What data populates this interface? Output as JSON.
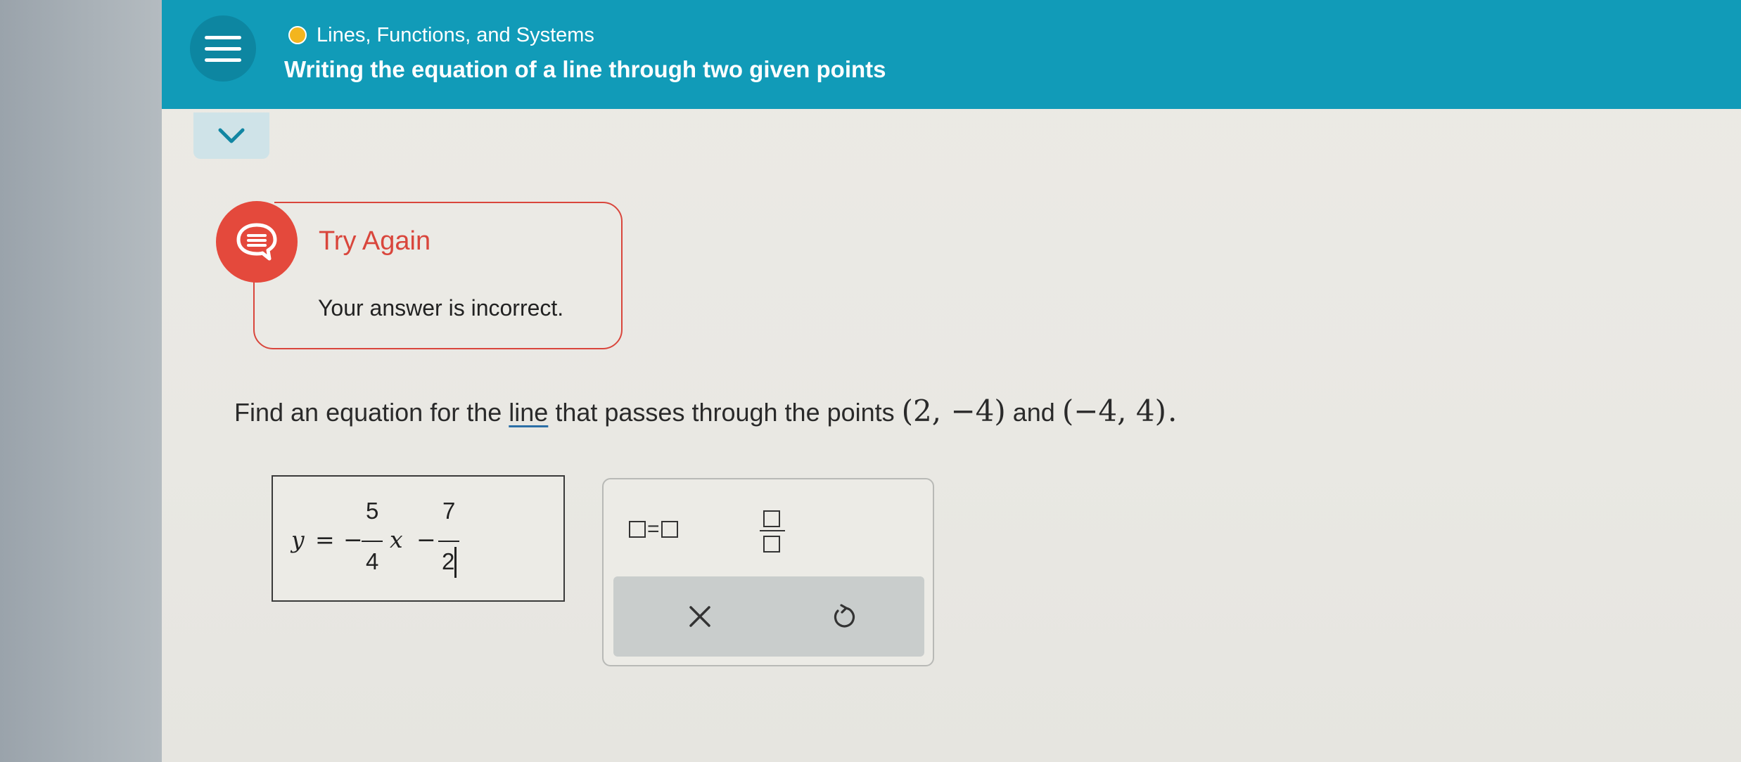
{
  "header": {
    "topic": "Lines, Functions, and Systems",
    "lesson_title": "Writing the equation of a line through two given points",
    "menu_icon": "hamburger-icon",
    "topic_status_color": "#f3b51f",
    "bar_color": "#119bb8"
  },
  "collapse": {
    "icon": "chevron-down-icon"
  },
  "feedback": {
    "title": "Try Again",
    "message": "Your answer is incorrect.",
    "icon": "speech-bubble-icon",
    "accent_color": "#d9463c"
  },
  "question": {
    "prefix": "Find an equation for the",
    "link_text": "line",
    "middle": "that passes through the points",
    "point1": "(2, −4)",
    "conjunction": "and",
    "point2": "(−4, 4)",
    "suffix": "."
  },
  "answer": {
    "lhs": "y",
    "equals": "=",
    "minus1": "−",
    "frac1_num": "5",
    "frac1_den": "4",
    "var": "x",
    "minus2": "−",
    "frac2_num": "7",
    "frac2_den": "2"
  },
  "tools": {
    "equals_template": "=",
    "equals_icon": "equation-template-icon",
    "fraction_icon": "fraction-template-icon",
    "clear_icon": "clear-x-icon",
    "undo_icon": "undo-icon"
  }
}
